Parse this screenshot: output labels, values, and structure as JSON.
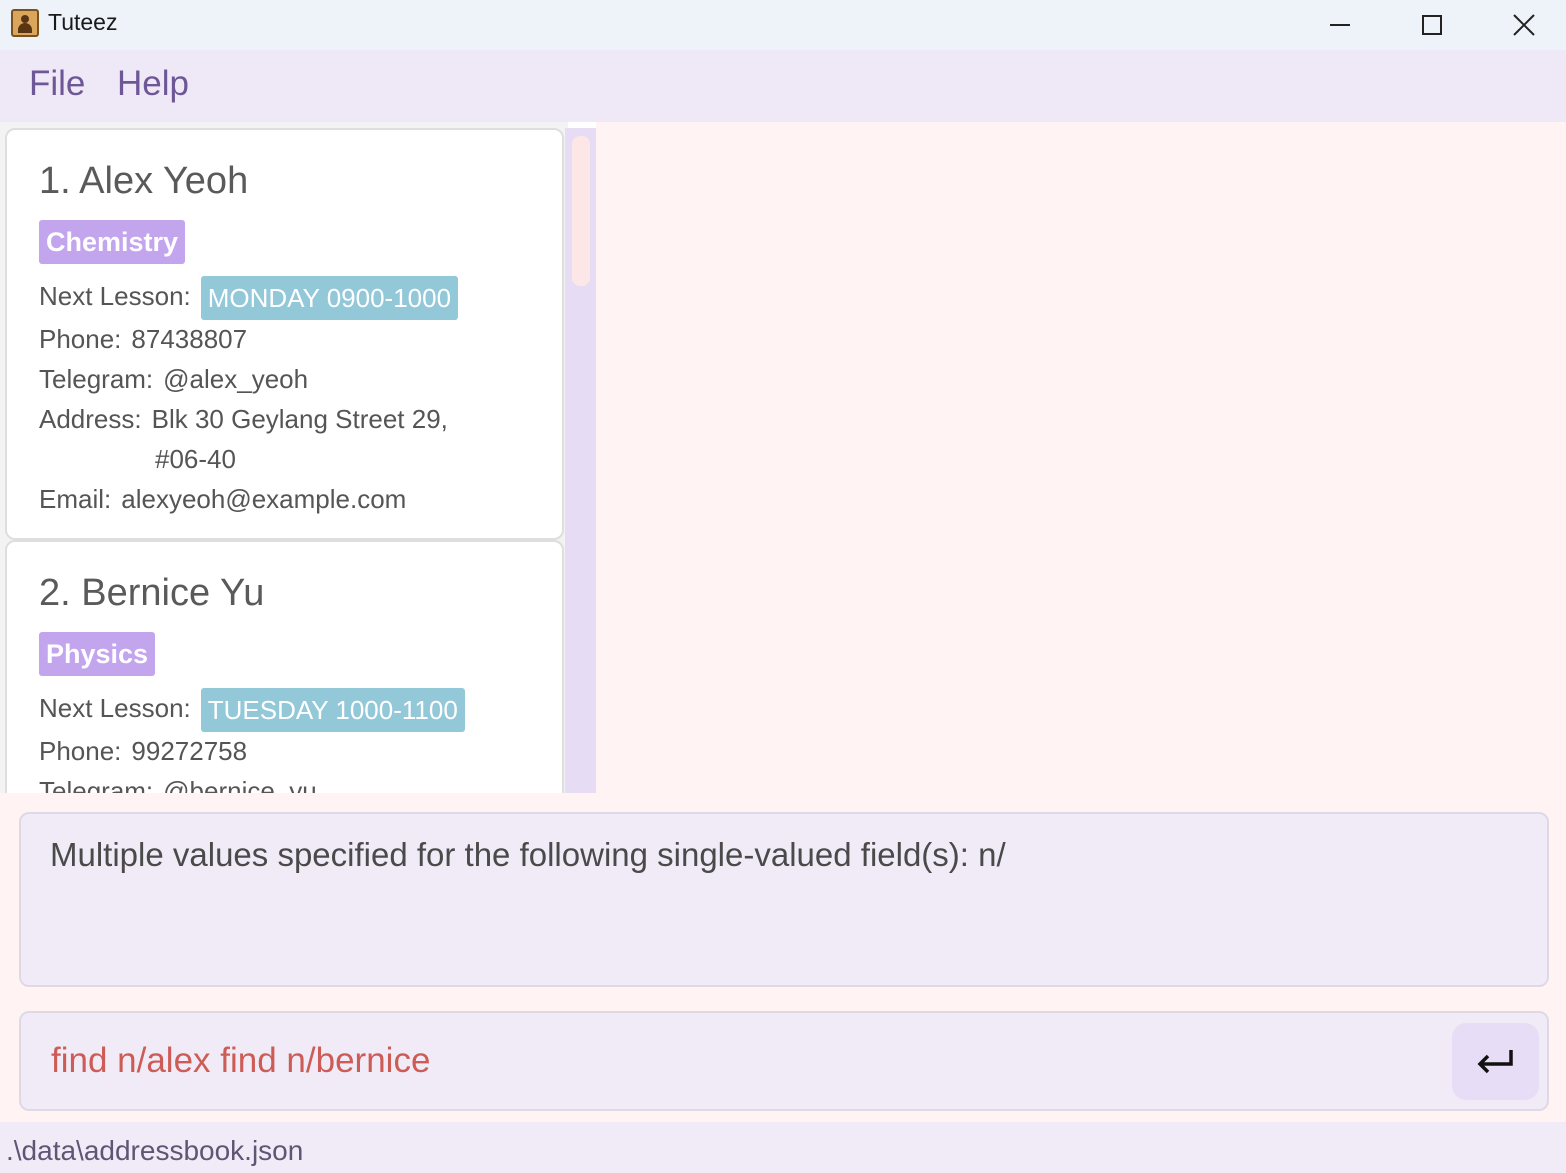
{
  "window": {
    "title": "Tuteez"
  },
  "menu": {
    "items": [
      "File",
      "Help"
    ]
  },
  "persons": [
    {
      "index_name": "1. Alex Yeoh",
      "subject": "Chemistry",
      "next_lesson_label": "Next Lesson:",
      "next_lesson": "MONDAY 0900-1000",
      "phone_label": "Phone:",
      "phone": "87438807",
      "telegram_label": "Telegram:",
      "telegram": "@alex_yeoh",
      "address_label": "Address:",
      "address_line1": "Blk 30 Geylang Street 29,",
      "address_line2": "#06-40",
      "email_label": "Email:",
      "email": "alexyeoh@example.com"
    },
    {
      "index_name": "2. Bernice Yu",
      "subject": "Physics",
      "next_lesson_label": "Next Lesson:",
      "next_lesson": "TUESDAY 1000-1100",
      "phone_label": "Phone:",
      "phone": "99272758",
      "telegram_label": "Telegram:",
      "telegram": "@bernice_yu"
    }
  ],
  "result": {
    "message": "Multiple values specified for the following single-valued field(s): n/"
  },
  "command": {
    "value": "find n/alex find n/bernice"
  },
  "status": {
    "file_path": ".\\data\\addressbook.json"
  },
  "colors": {
    "subject_tag": "#c3a5ee",
    "lesson_tag": "#93c8d8",
    "command_text": "#cc5c55",
    "menu_text": "#6e5796"
  }
}
